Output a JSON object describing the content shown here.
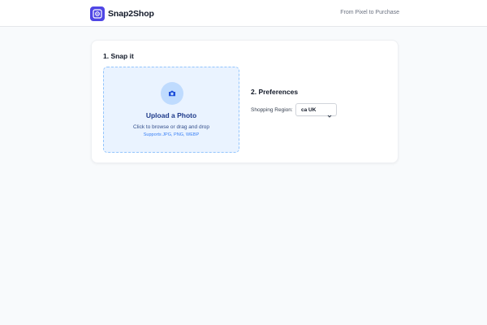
{
  "header": {
    "brand": "Snap2Shop",
    "tagline": "From Pixel to Purchase",
    "logo_icon": "snap-logo-icon",
    "brand_color": "#4f46e5"
  },
  "step1": {
    "title": "1. Snap it",
    "upload": {
      "icon": "camera-icon",
      "title": "Upload a Photo",
      "instruction": "Click to browse or drag and drop",
      "supported": "Supports JPG, PNG, WEBP"
    }
  },
  "step2": {
    "title": "2. Preferences",
    "region_label": "Shopping Region:",
    "region_value": "🇨🇦 UK",
    "region_value_display": "ca UK"
  }
}
